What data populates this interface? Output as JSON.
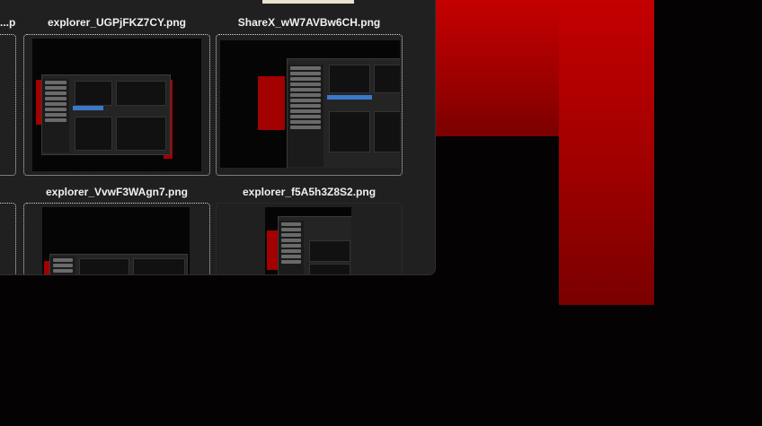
{
  "desktop": {
    "accent": "#c00000",
    "background": "#050203"
  },
  "explorer": {
    "top_partial_label": "...p...",
    "tiles": [
      {
        "name": "explorer_UGPjFKZ7CY.png",
        "selected": true
      },
      {
        "name": "ShareX_wW7AVBw6CH.png",
        "selected": true
      },
      {
        "name": "explorer_VvwF3WAgn7.png",
        "selected": true
      },
      {
        "name": "explorer_f5A5h3Z8S2.png",
        "selected": false
      }
    ]
  }
}
